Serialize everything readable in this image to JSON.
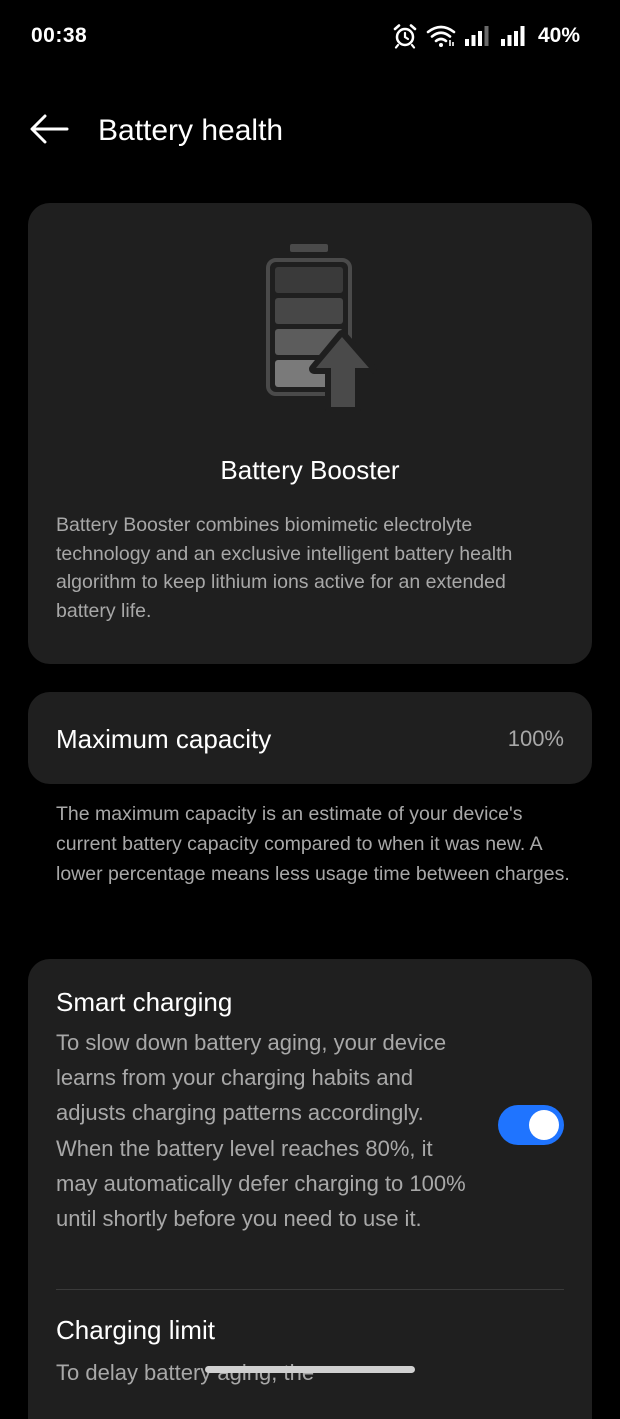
{
  "status_bar": {
    "time": "00:38",
    "battery_percent": "40%",
    "icons": [
      "alarm-icon",
      "wifi-icon",
      "signal-icon",
      "signal-icon"
    ]
  },
  "header": {
    "title": "Battery health",
    "back_icon": "arrow-left-icon"
  },
  "booster": {
    "icon": "battery-boost-icon",
    "title": "Battery Booster",
    "description": "Battery Booster combines biomimetic electrolyte technology and an exclusive intelligent battery health algorithm to keep lithium ions active for an extended battery life."
  },
  "capacity": {
    "label": "Maximum capacity",
    "value": "100%",
    "note": "The maximum capacity is an estimate of your device's current battery capacity compared to when it was new. A lower percentage means less usage time between charges."
  },
  "smart_charging": {
    "title": "Smart charging",
    "description": "To slow down battery aging, your device learns from your charging habits and adjusts charging patterns accordingly. When the battery level reaches 80%, it may automatically defer charging to 100% until shortly before you need to use it.",
    "enabled": true
  },
  "charging_limit": {
    "title": "Charging limit",
    "description": "To delay battery aging, the"
  },
  "colors": {
    "background": "#000000",
    "card": "#1f1f1f",
    "primary_text": "#ffffff",
    "secondary_text": "#a8a8a8",
    "accent": "#1f74ff"
  }
}
